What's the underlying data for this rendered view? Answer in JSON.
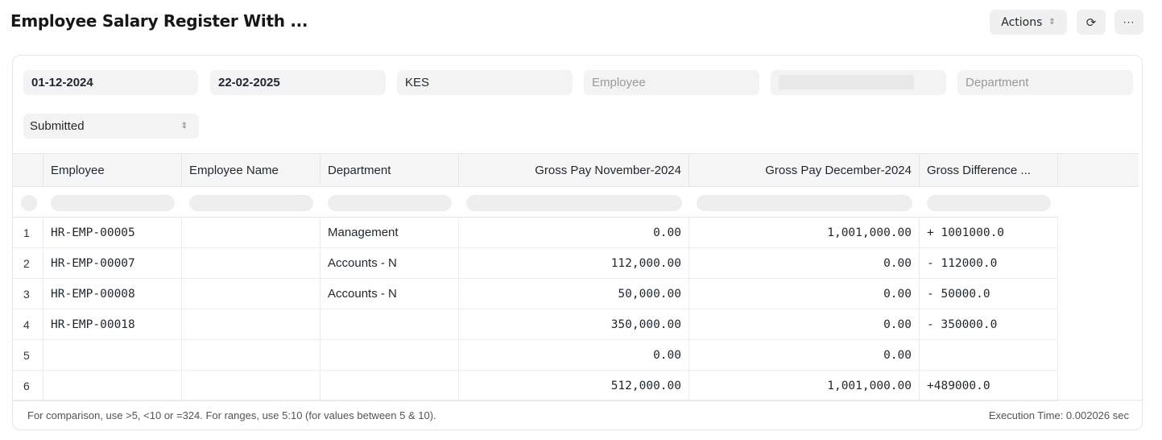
{
  "page": {
    "title": "Employee Salary Register With ...",
    "actions_label": "Actions",
    "refresh_icon": "refresh-icon",
    "more_icon": "more-icon",
    "more_label": "···"
  },
  "filters": {
    "from_date": "01-12-2024",
    "to_date": "22-02-2025",
    "currency": "KES",
    "employee_placeholder": "Employee",
    "department_placeholder": "Department",
    "status": "Submitted"
  },
  "table": {
    "columns": [
      "Employee",
      "Employee Name",
      "Department",
      "Gross Pay November-2024",
      "Gross Pay December-2024",
      "Gross Difference ..."
    ],
    "rows": [
      {
        "index": "1",
        "employee": "HR-EMP-00005",
        "employee_name": "",
        "department": "Management",
        "gross_nov": "0.00",
        "gross_dec": "1,001,000.00",
        "difference": "+ 1001000.0"
      },
      {
        "index": "2",
        "employee": "HR-EMP-00007",
        "employee_name": "",
        "department": "Accounts - N",
        "gross_nov": "112,000.00",
        "gross_dec": "0.00",
        "difference": "- 112000.0"
      },
      {
        "index": "3",
        "employee": "HR-EMP-00008",
        "employee_name": "",
        "department": "Accounts - N",
        "gross_nov": "50,000.00",
        "gross_dec": "0.00",
        "difference": "- 50000.0"
      },
      {
        "index": "4",
        "employee": "HR-EMP-00018",
        "employee_name": "",
        "department": "",
        "gross_nov": "350,000.00",
        "gross_dec": "0.00",
        "difference": "- 350000.0"
      },
      {
        "index": "5",
        "employee": "",
        "employee_name": "",
        "department": "",
        "gross_nov": "0.00",
        "gross_dec": "0.00",
        "difference": ""
      },
      {
        "index": "6",
        "employee": "",
        "employee_name": "",
        "department": "",
        "gross_nov": "512,000.00",
        "gross_dec": "1,001,000.00",
        "difference": "+489000.0"
      }
    ]
  },
  "footer": {
    "note": "For comparison, use >5, <10 or =324. For ranges, use 5:10 (for values between 5 & 10).",
    "execution_time": "Execution Time: 0.002026 sec"
  }
}
